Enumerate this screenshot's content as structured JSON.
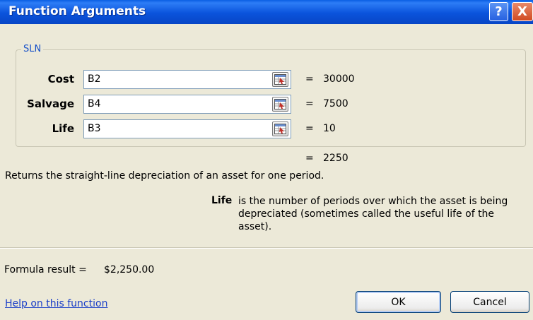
{
  "window": {
    "title": "Function Arguments",
    "help_button": "?",
    "close_button": "X"
  },
  "function": {
    "name": "SLN",
    "args": [
      {
        "label": "Cost",
        "value": "B2",
        "result": "30000"
      },
      {
        "label": "Salvage",
        "value": "B4",
        "result": "7500"
      },
      {
        "label": "Life",
        "value": "B3",
        "result": "10"
      }
    ],
    "equals": "=",
    "total": "2250",
    "description": "Returns the straight-line depreciation of an asset for one period."
  },
  "help": {
    "term": "Life",
    "text": "is the number of periods over which the asset is being depreciated (sometimes called the useful life of the asset)."
  },
  "footer": {
    "formula_label": "Formula result =",
    "formula_value": "$2,250.00",
    "help_link": "Help on this function",
    "ok_label": "OK",
    "cancel_label": "Cancel"
  },
  "icons": {
    "ref_button": "collapse-dialog-icon"
  },
  "colors": {
    "titlebar": "#0a53dc",
    "dialog_bg": "#ECE9D8",
    "link": "#1a3fc8",
    "group_label": "#1650c8"
  }
}
